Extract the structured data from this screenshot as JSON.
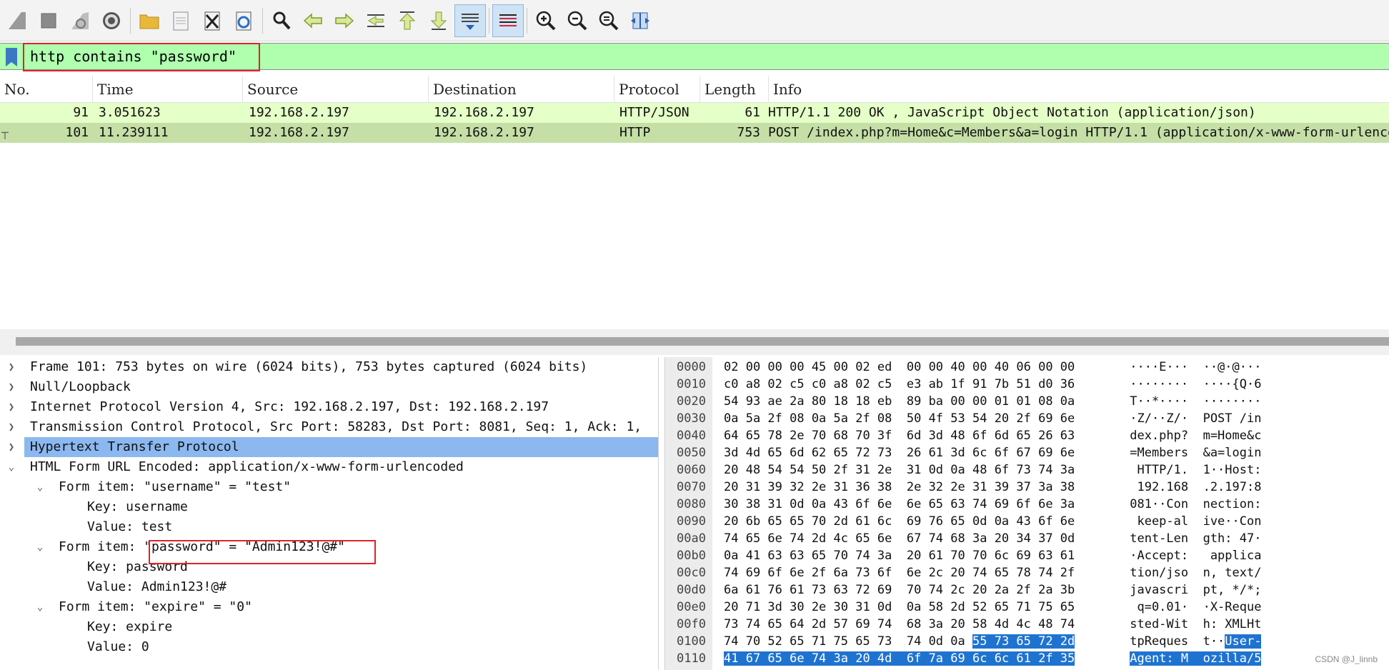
{
  "toolbar": {
    "buttons": [
      "shark-fin-start-icon",
      "stop-capture-icon",
      "restart-capture-icon",
      "capture-options-gear-icon",
      "open-folder-icon",
      "save-file-icon",
      "close-file-icon",
      "reload-file-icon",
      "find-packet-icon",
      "go-back-icon",
      "go-forward-icon",
      "go-to-packet-icon",
      "go-first-packet-icon",
      "go-last-packet-icon",
      "autoscroll-icon",
      "colorize-icon",
      "zoom-in-icon",
      "zoom-out-icon",
      "normal-size-icon",
      "resize-columns-icon"
    ]
  },
  "filter": {
    "value": "http contains \"password\""
  },
  "packet_list": {
    "columns": [
      "No.",
      "Time",
      "Source",
      "Destination",
      "Protocol",
      "Length",
      "Info"
    ],
    "rows": [
      {
        "no": "91",
        "time": "3.051623",
        "source": "192.168.2.197",
        "destination": "192.168.2.197",
        "protocol": "HTTP/JSON",
        "length": "61",
        "info": "HTTP/1.1 200 OK , JavaScript Object Notation (application/json)"
      },
      {
        "no": "101",
        "time": "11.239111",
        "source": "192.168.2.197",
        "destination": "192.168.2.197",
        "protocol": "HTTP",
        "length": "753",
        "info": "POST /index.php?m=Home&c=Members&a=login HTTP/1.1  (application/x-www-form-urlencoded)"
      }
    ]
  },
  "details": {
    "frame": "Frame 101: 753 bytes on wire (6024 bits), 753 bytes captured (6024 bits)",
    "null_loopback": "Null/Loopback",
    "ip": "Internet Protocol Version 4, Src: 192.168.2.197, Dst: 192.168.2.197",
    "tcp": "Transmission Control Protocol, Src Port: 58283, Dst Port: 8081, Seq: 1, Ack: 1,",
    "http": "Hypertext Transfer Protocol",
    "form": "HTML Form URL Encoded: application/x-www-form-urlencoded",
    "item1": "Form item: \"username\" = \"test\"",
    "item1_key": "Key: username",
    "item1_value": "Value: test",
    "item2": "Form item: \"password\" = \"Admin123!@#\"",
    "item2_key": "Key: password",
    "item2_value": "Value: Admin123!@#",
    "item3": "Form item: \"expire\" = \"0\"",
    "item3_key": "Key: expire",
    "item3_value": "Value: 0"
  },
  "bytes": {
    "rows": [
      {
        "offset": "0000",
        "hex": "02 00 00 00 45 00 02 ed  00 00 40 00 40 06 00 00",
        "ascii": " ····E···  ··@·@···"
      },
      {
        "offset": "0010",
        "hex": "c0 a8 02 c5 c0 a8 02 c5  e3 ab 1f 91 7b 51 d0 36",
        "ascii": " ········  ····{Q·6"
      },
      {
        "offset": "0020",
        "hex": "54 93 ae 2a 80 18 18 eb  89 ba 00 00 01 01 08 0a",
        "ascii": " T··*····  ········"
      },
      {
        "offset": "0030",
        "hex": "0a 5a 2f 08 0a 5a 2f 08  50 4f 53 54 20 2f 69 6e",
        "ascii": " ·Z/··Z/·  POST /in"
      },
      {
        "offset": "0040",
        "hex": "64 65 78 2e 70 68 70 3f  6d 3d 48 6f 6d 65 26 63",
        "ascii": " dex.php?  m=Home&c"
      },
      {
        "offset": "0050",
        "hex": "3d 4d 65 6d 62 65 72 73  26 61 3d 6c 6f 67 69 6e",
        "ascii": " =Members  &a=login"
      },
      {
        "offset": "0060",
        "hex": "20 48 54 54 50 2f 31 2e  31 0d 0a 48 6f 73 74 3a",
        "ascii": "  HTTP/1.  1··Host:"
      },
      {
        "offset": "0070",
        "hex": "20 31 39 32 2e 31 36 38  2e 32 2e 31 39 37 3a 38",
        "ascii": "  192.168  .2.197:8"
      },
      {
        "offset": "0080",
        "hex": "30 38 31 0d 0a 43 6f 6e  6e 65 63 74 69 6f 6e 3a",
        "ascii": " 081··Con  nection:"
      },
      {
        "offset": "0090",
        "hex": "20 6b 65 65 70 2d 61 6c  69 76 65 0d 0a 43 6f 6e",
        "ascii": "  keep-al  ive··Con"
      },
      {
        "offset": "00a0",
        "hex": "74 65 6e 74 2d 4c 65 6e  67 74 68 3a 20 34 37 0d",
        "ascii": " tent-Len  gth: 47·"
      },
      {
        "offset": "00b0",
        "hex": "0a 41 63 63 65 70 74 3a  20 61 70 70 6c 69 63 61",
        "ascii": " ·Accept:   applica"
      },
      {
        "offset": "00c0",
        "hex": "74 69 6f 6e 2f 6a 73 6f  6e 2c 20 74 65 78 74 2f",
        "ascii": " tion/jso  n, text/"
      },
      {
        "offset": "00d0",
        "hex": "6a 61 76 61 73 63 72 69  70 74 2c 20 2a 2f 2a 3b",
        "ascii": " javascri  pt, */*;"
      },
      {
        "offset": "00e0",
        "hex": "20 71 3d 30 2e 30 31 0d  0a 58 2d 52 65 71 75 65",
        "ascii": "  q=0.01·  ·X-Reque"
      },
      {
        "offset": "00f0",
        "hex": "73 74 65 64 2d 57 69 74  68 3a 20 58 4d 4c 48 74",
        "ascii": " sted-Wit  h: XMLHt"
      },
      {
        "offset": "0100",
        "hex": "74 70 52 65 71 75 65 73  74 0d 0a ",
        "hex_hl": "55 73 65 72 2d",
        "ascii": " tpReques  t··",
        "ascii_hl": "User-"
      },
      {
        "offset": "0110",
        "hex": "",
        "hex_hl": "41 67 65 6e 74 3a 20 4d  6f 7a 69 6c 6c 61 2f 35",
        "ascii": " ",
        "ascii_hl": "Agent: M  ozilla/5"
      }
    ]
  },
  "watermark": "CSDN @J_linnb"
}
